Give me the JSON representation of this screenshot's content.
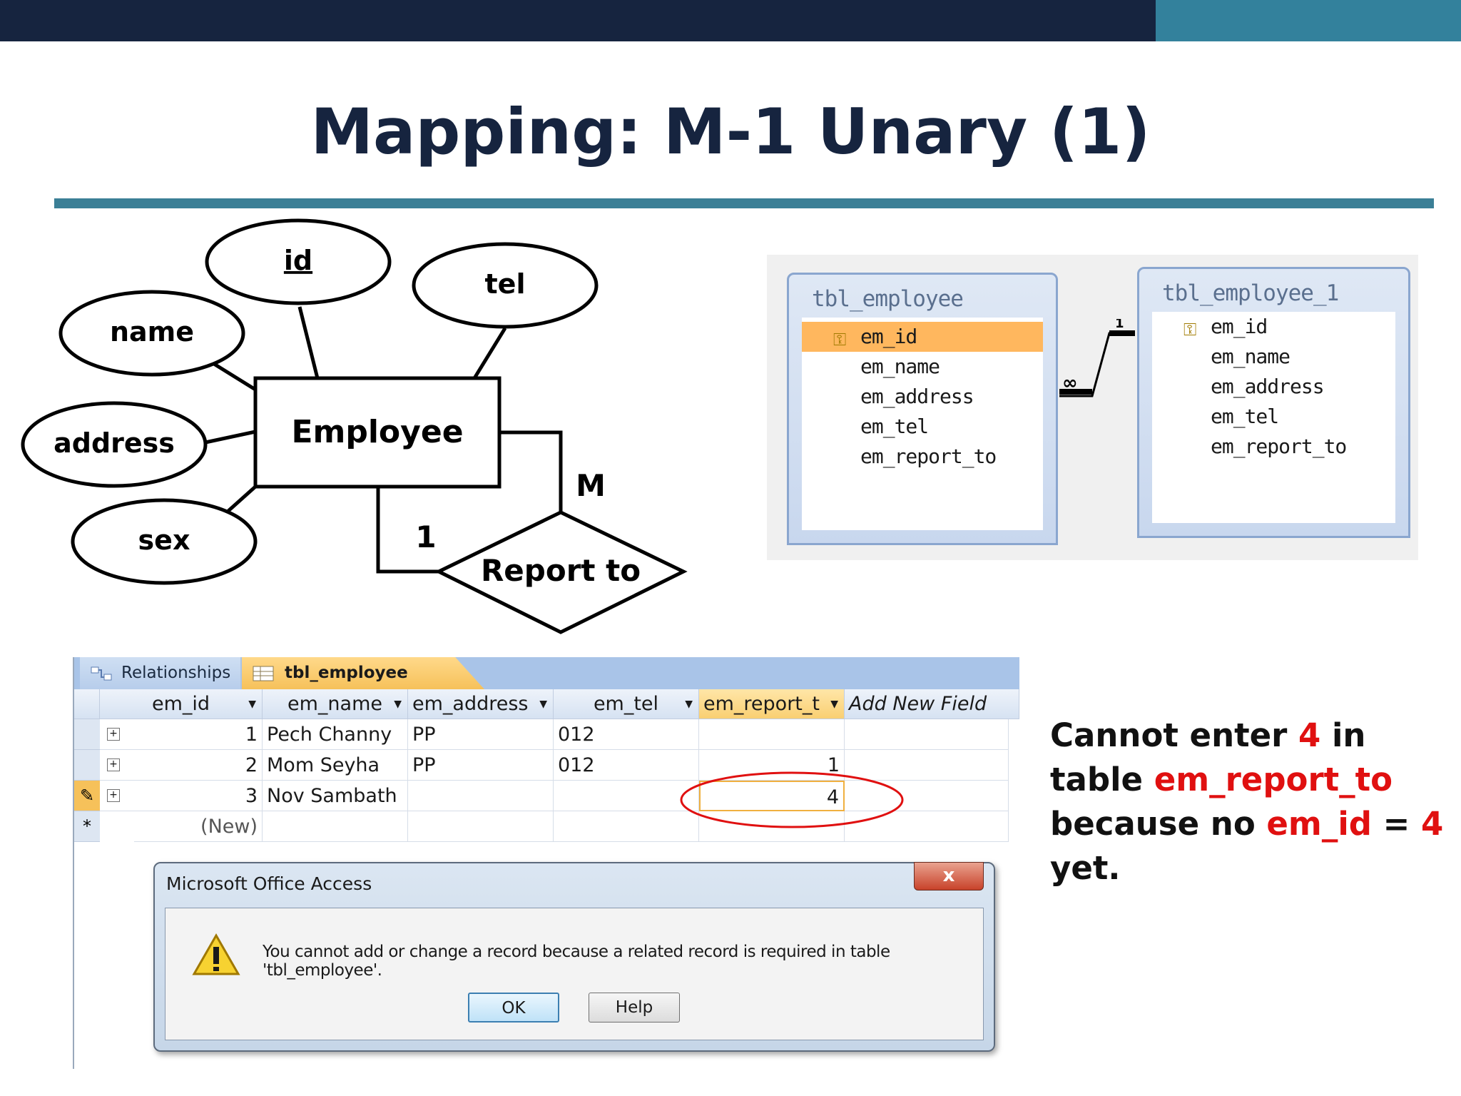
{
  "colors": {
    "dark_navy": "#16243f",
    "teal": "#33819c",
    "rule": "#3b7f96",
    "red": "#e01010"
  },
  "slide": {
    "title": "Mapping: M-1 Unary (1)"
  },
  "er_diagram": {
    "entity": "Employee",
    "attributes": {
      "id": "id",
      "name": "name",
      "tel": "tel",
      "address": "address",
      "sex": "sex"
    },
    "relationship": "Report to",
    "cardinality_many": "M",
    "cardinality_one": "1"
  },
  "relationships_view": {
    "left_table": {
      "name": "tbl_employee",
      "fields": [
        "em_id",
        "em_name",
        "em_address",
        "em_tel",
        "em_report_to"
      ]
    },
    "right_table": {
      "name": "tbl_employee_1",
      "fields": [
        "em_id",
        "em_name",
        "em_address",
        "em_tel",
        "em_report_to"
      ]
    },
    "one_label": "1",
    "many_label": "∞"
  },
  "access": {
    "tabs": {
      "relationships": "Relationships",
      "table": "tbl_employee"
    },
    "columns": [
      "em_id",
      "em_name",
      "em_address",
      "em_tel",
      "em_report_t",
      "Add New Field"
    ],
    "rows": [
      {
        "em_id": "1",
        "em_name": "Pech Channy",
        "em_address": "PP",
        "em_tel": "012",
        "em_report_to": ""
      },
      {
        "em_id": "2",
        "em_name": "Mom Seyha",
        "em_address": "PP",
        "em_tel": "012",
        "em_report_to": "1"
      },
      {
        "em_id": "3",
        "em_name": "Nov Sambath",
        "em_address": "",
        "em_tel": "",
        "em_report_to": "4"
      }
    ],
    "new_row_label": "(New)",
    "new_row_marker": "*",
    "dialog": {
      "title": "Microsoft Office Access",
      "message": "You cannot add or change a record because a related record is required in table 'tbl_employee'.",
      "ok": "OK",
      "help": "Help",
      "close": "x"
    }
  },
  "explanation": {
    "part1": "Cannot enter ",
    "value1": "4",
    "part2": " in",
    "part3": "table ",
    "field1": "em_report_to",
    "part4": "because no ",
    "field2": "em_id",
    "part5": " = ",
    "value2": "4",
    "part6": " yet."
  }
}
